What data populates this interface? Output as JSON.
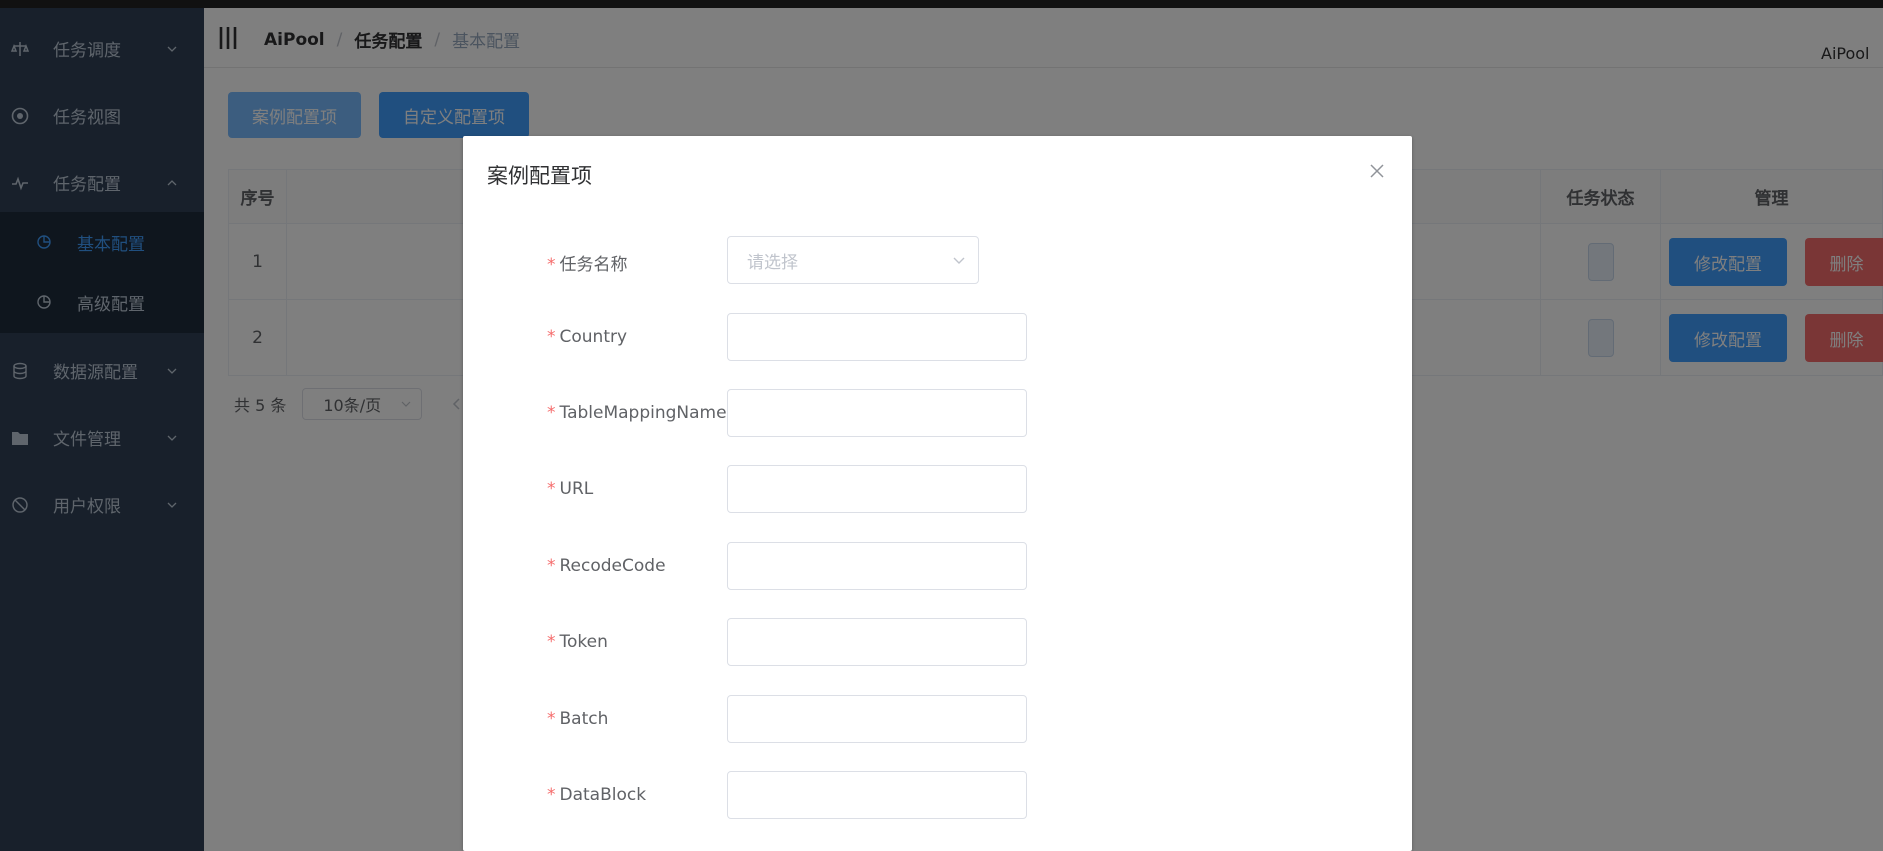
{
  "sidebar": {
    "items": [
      {
        "label": "任务调度",
        "icon": "scale-icon",
        "arrow": "down"
      },
      {
        "label": "任务视图",
        "icon": "aperture-icon",
        "arrow": "none"
      },
      {
        "label": "任务配置",
        "icon": "pulse-icon",
        "arrow": "up"
      },
      {
        "label": "数据源配置",
        "icon": "database-icon",
        "arrow": "down"
      },
      {
        "label": "文件管理",
        "icon": "folder-icon",
        "arrow": "down"
      },
      {
        "label": "用户权限",
        "icon": "no-entry-icon",
        "arrow": "down"
      }
    ],
    "subitems": [
      {
        "label": "基本配置",
        "icon": "pie-chart-icon",
        "active": true
      },
      {
        "label": "高级配置",
        "icon": "pie-chart-icon",
        "active": false
      }
    ]
  },
  "header": {
    "breadcrumb": [
      "AiPool",
      "任务配置",
      "基本配置"
    ],
    "separator": "/",
    "user_name": "AiPool"
  },
  "toolbar": {
    "case_config_label": "案例配置项",
    "custom_config_label": "自定义配置项"
  },
  "table": {
    "columns": {
      "index": "序号",
      "status": "任务状态",
      "manage": "管理"
    },
    "rows": [
      {
        "index": "1",
        "edit_label": "修改配置",
        "delete_label": "删除"
      },
      {
        "index": "2",
        "edit_label": "修改配置",
        "delete_label": "删除"
      }
    ]
  },
  "pagination": {
    "total": "共 5 条",
    "page_size": "10条/页"
  },
  "dialog": {
    "title": "案例配置项",
    "required_mark": "*",
    "task_name": {
      "label": "任务名称",
      "placeholder": "请选择"
    },
    "fields": [
      {
        "label": "Country",
        "value": ""
      },
      {
        "label": "TableMappingName",
        "value": ""
      },
      {
        "label": "URL",
        "value": ""
      },
      {
        "label": "RecodeCode",
        "value": ""
      },
      {
        "label": "Token",
        "value": ""
      },
      {
        "label": "Batch",
        "value": ""
      },
      {
        "label": "DataBlock",
        "value": ""
      }
    ]
  },
  "colors": {
    "sidebar_bg": "#304156",
    "submenu_bg": "#1f2d3d",
    "primary": "#409eff",
    "danger": "#f56c6c",
    "active_text": "#409eff"
  }
}
